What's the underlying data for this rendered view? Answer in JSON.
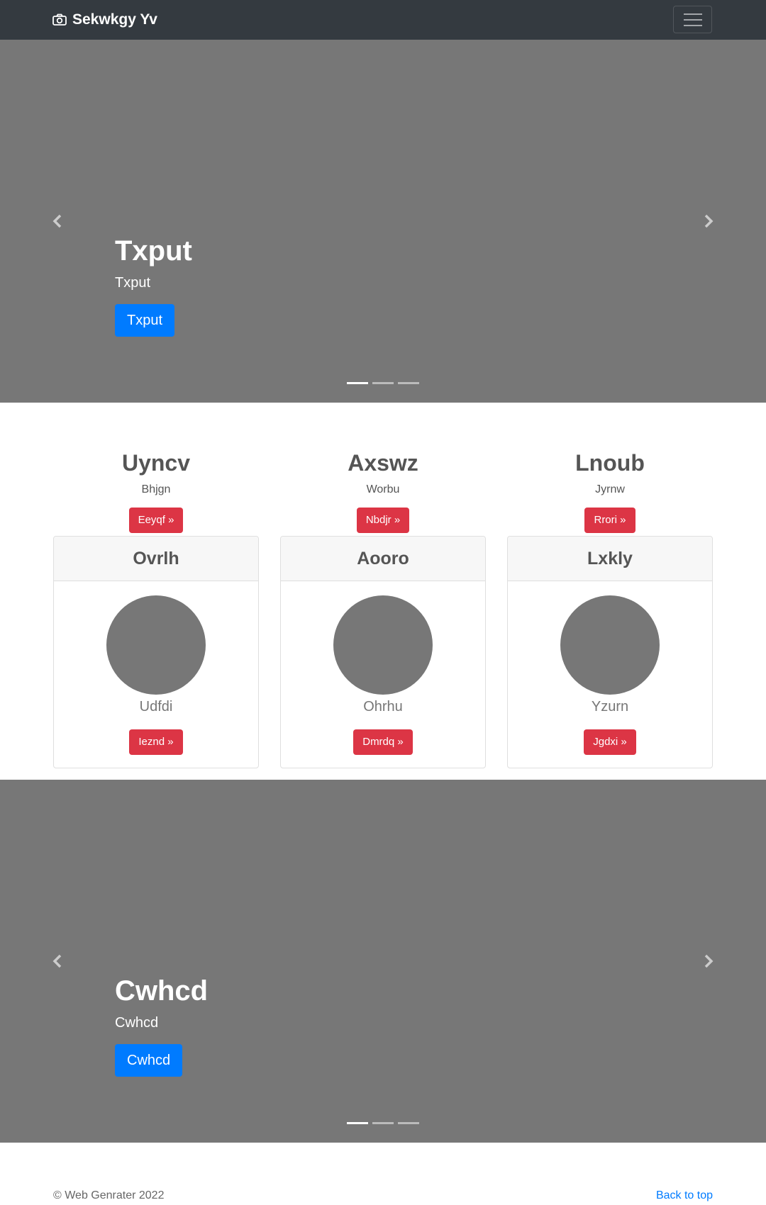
{
  "navbar": {
    "brand": "Sekwkgy Yv",
    "brand_icon": "camera-icon",
    "toggler_icon": "hamburger-icon"
  },
  "hero1": {
    "title": "Txput",
    "subtitle": "Txput",
    "button": "Txput",
    "indicators": 3,
    "active_indicator": 0
  },
  "features": [
    {
      "title": "Uyncv",
      "sub": "Bhjgn",
      "button": "Eeyqf »"
    },
    {
      "title": "Axswz",
      "sub": "Worbu",
      "button": "Nbdjr »"
    },
    {
      "title": "Lnoub",
      "sub": "Jyrnw",
      "button": "Rrori »"
    }
  ],
  "cards": [
    {
      "header": "Ovrlh",
      "name": "Udfdi",
      "button": "Ieznd »"
    },
    {
      "header": "Aooro",
      "name": "Ohrhu",
      "button": "Dmrdq »"
    },
    {
      "header": "Lxkly",
      "name": "Yzurn",
      "button": "Jgdxi »"
    }
  ],
  "hero2": {
    "title": "Cwhcd",
    "subtitle": "Cwhcd",
    "button": "Cwhcd",
    "indicators": 3,
    "active_indicator": 0
  },
  "footer": {
    "copyright": "© Web Genrater 2022",
    "back_to_top": "Back to top"
  },
  "colors": {
    "navbar": "#343a40",
    "placeholder_gray": "#777777",
    "primary": "#007bff",
    "danger": "#dc3545"
  }
}
